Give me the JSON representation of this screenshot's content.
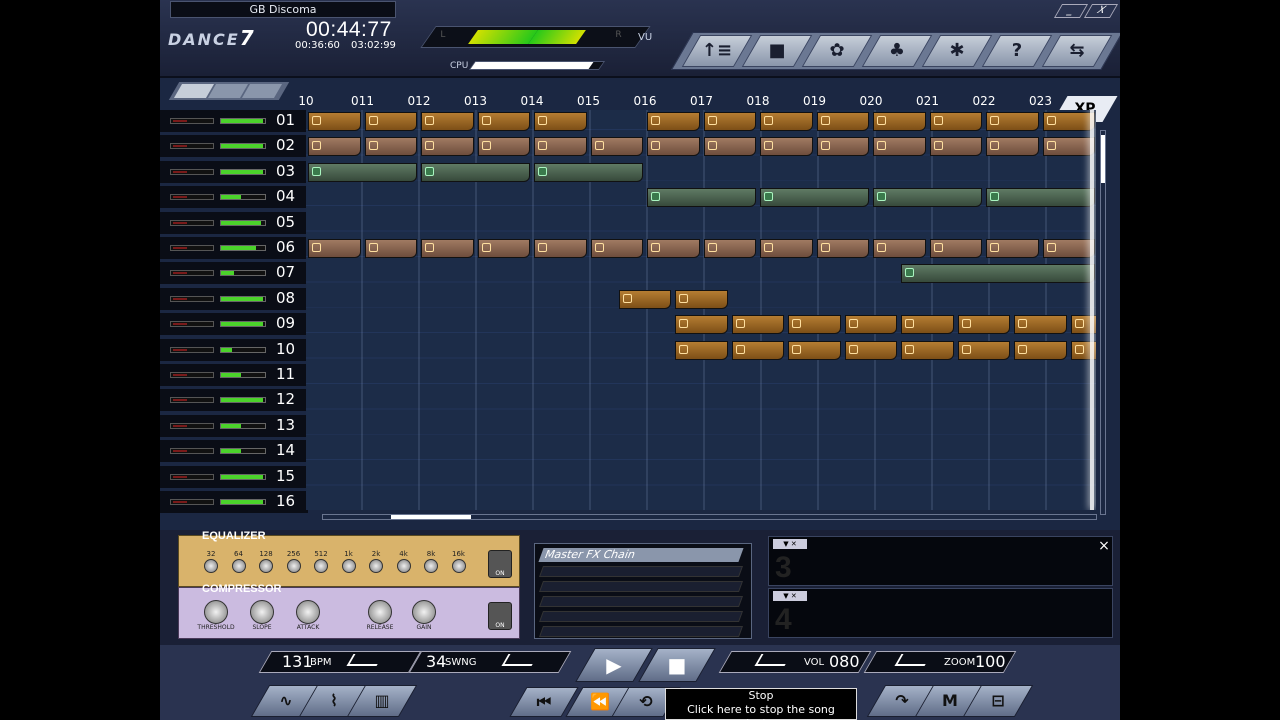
{
  "header": {
    "song_title": "GB Discoma",
    "logo_text": "DANCE",
    "logo_version": "7",
    "time_main": "00:44:77",
    "time_a": "00:36:60",
    "time_b": "03:02:99",
    "vu_label": "VU",
    "vu_left": "L",
    "vu_right": "R",
    "cpu_label": "CPU",
    "cpu_level": 0.92
  },
  "toolbar": [
    {
      "name": "tracks-icon",
      "glyph": "↑≡"
    },
    {
      "name": "folder-icon",
      "glyph": "■"
    },
    {
      "name": "drums-icon",
      "glyph": "✿"
    },
    {
      "name": "sampler-icon",
      "glyph": "♣"
    },
    {
      "name": "effects-icon",
      "glyph": "✱"
    },
    {
      "name": "help-icon",
      "glyph": "?"
    },
    {
      "name": "export-icon",
      "glyph": "⇆"
    }
  ],
  "window": {
    "minimize": "_",
    "close": "X"
  },
  "sequencer": {
    "bars": [
      "10",
      "011",
      "012",
      "013",
      "014",
      "015",
      "016",
      "017",
      "018",
      "019",
      "020",
      "021",
      "022",
      "023"
    ],
    "xp_label": "XP",
    "tracks": [
      {
        "num": "01",
        "vol": 0.95
      },
      {
        "num": "02",
        "vol": 0.95
      },
      {
        "num": "03",
        "vol": 0.95
      },
      {
        "num": "04",
        "vol": 0.45
      },
      {
        "num": "05",
        "vol": 0.92
      },
      {
        "num": "06",
        "vol": 0.8
      },
      {
        "num": "07",
        "vol": 0.3
      },
      {
        "num": "08",
        "vol": 0.95
      },
      {
        "num": "09",
        "vol": 0.95
      },
      {
        "num": "10",
        "vol": 0.25
      },
      {
        "num": "11",
        "vol": 0.45
      },
      {
        "num": "12",
        "vol": 0.95
      },
      {
        "num": "13",
        "vol": 0.45
      },
      {
        "num": "14",
        "vol": 0.45
      },
      {
        "num": "15",
        "vol": 0.95
      },
      {
        "num": "16",
        "vol": 0.95
      }
    ]
  },
  "fx": {
    "equalizer_title": "EQUALIZER",
    "eq_bands": [
      "32",
      "64",
      "128",
      "256",
      "512",
      "1k",
      "2k",
      "4k",
      "8k",
      "16k"
    ],
    "compressor_title": "COMPRESSOR",
    "comp_knobs": [
      "THRESHOLD",
      "SLOPE",
      "ATTACK",
      "RELEASE",
      "GAIN"
    ],
    "on_label": "ON",
    "chain_title": "Master FX Chain",
    "slot3": "3",
    "slot4": "4",
    "close": "×"
  },
  "transport": {
    "bpm": "131",
    "bpm_unit": "BPM",
    "swing": "34",
    "swing_unit": "SWNG",
    "vol_unit": "VOL",
    "vol": "080",
    "zoom_unit": "ZOOM",
    "zoom": "100",
    "play_glyph": "▶",
    "stop_glyph": "■",
    "rewind_start_glyph": "⏮",
    "rewind_glyph": "⏪",
    "loop_glyph": "⟲",
    "tooltip_title": "Stop",
    "tooltip_text": "Click here to stop the song playing.",
    "bottom_left": [
      {
        "name": "waveform-icon",
        "glyph": "∿"
      },
      {
        "name": "envelope-icon",
        "glyph": "⌇"
      },
      {
        "name": "piano-icon",
        "glyph": "▥"
      }
    ],
    "bottom_right": [
      {
        "name": "redo-icon",
        "glyph": "↷"
      },
      {
        "name": "mix-icon",
        "glyph": "M"
      },
      {
        "name": "settings-icon",
        "glyph": "⊟"
      }
    ]
  }
}
